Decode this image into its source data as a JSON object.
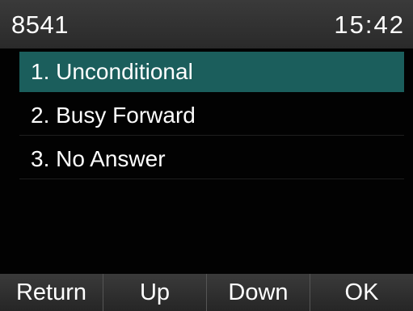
{
  "status": {
    "account": "8541",
    "time": "15:42"
  },
  "menu": {
    "items": [
      {
        "label": "1. Unconditional",
        "selected": true
      },
      {
        "label": "2. Busy Forward",
        "selected": false
      },
      {
        "label": "3. No Answer",
        "selected": false
      }
    ]
  },
  "softkeys": {
    "return_label": "Return",
    "up_label": "Up",
    "down_label": "Down",
    "ok_label": "OK"
  },
  "colors": {
    "selection": "#1b5e5c",
    "bar": "#333333",
    "background": "#020202"
  }
}
